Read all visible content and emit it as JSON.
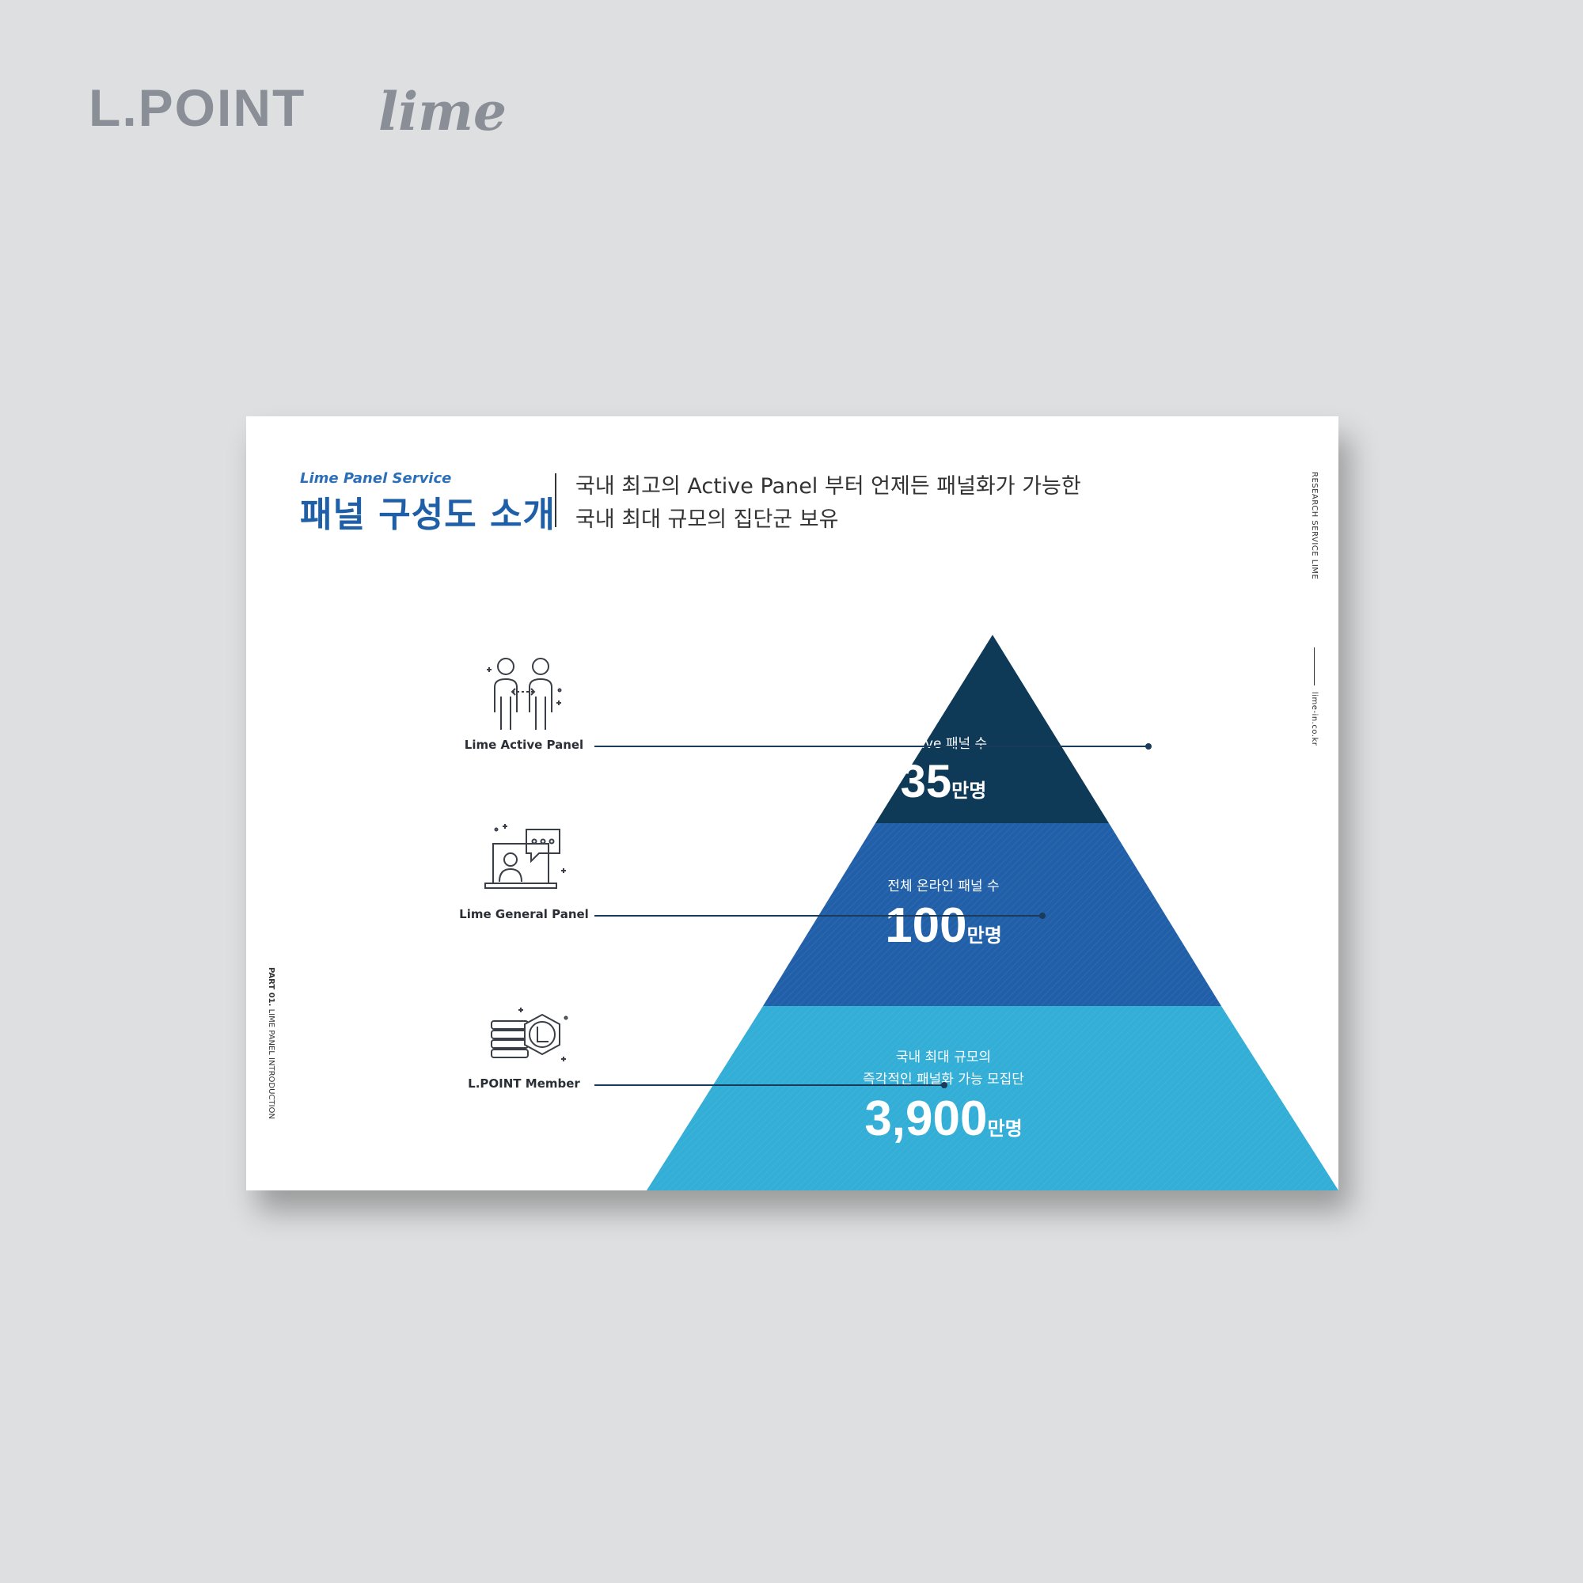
{
  "brand": {
    "lpoint": "L.POINT",
    "lime": "lime"
  },
  "header": {
    "eyebrow": "Lime Panel Service",
    "title": "패널 구성도 소개",
    "subtitle_line1": "국내 최고의 Active Panel 부터 언제든 패널화가 가능한",
    "subtitle_line2": "국내 최대 규모의 집단군 보유"
  },
  "side": {
    "right_main": "RESEARCH SERVICE LIME",
    "right_web": "lime-in.co.kr",
    "left_part": "PART 01.",
    "left_text": "LIME PANEL INTRODUCTION"
  },
  "pyramid": {
    "colors": {
      "top": "#0f3a57",
      "middle": "#2160a9",
      "bottom": "#33aed6"
    },
    "tiers": [
      {
        "label": "Active 패널 수",
        "value": "35",
        "unit": "만명"
      },
      {
        "label": "전체 온라인 패널 수",
        "value": "100",
        "unit": "만명"
      },
      {
        "label_line1": "국내 최대 규모의",
        "label_line2": "즉각적인 패널화 가능 모집단",
        "value": "3,900",
        "unit": "만명"
      }
    ]
  },
  "legend": [
    {
      "label": "Lime Active Panel",
      "icon": "people-exchange-icon"
    },
    {
      "label": "Lime General Panel",
      "icon": "laptop-chat-icon"
    },
    {
      "label": "L.POINT Member",
      "icon": "coins-l-badge-icon"
    }
  ]
}
